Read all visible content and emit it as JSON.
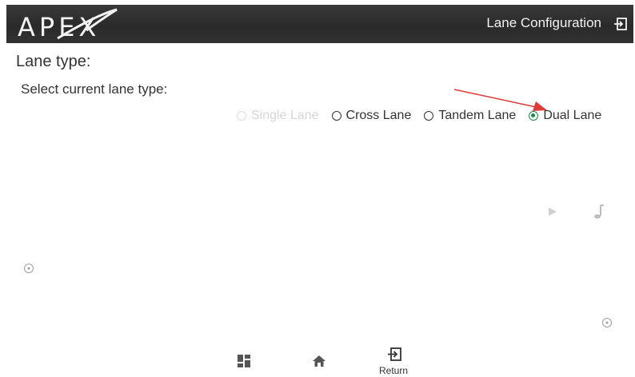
{
  "header": {
    "logo_text": "APEX",
    "title": "Lane Configuration",
    "exit_icon": "exit-icon"
  },
  "page": {
    "heading": "Lane type:",
    "subheading": "Select current lane type:"
  },
  "lane_options": [
    {
      "label": "Single Lane",
      "state": "disabled"
    },
    {
      "label": "Cross Lane",
      "state": "unselected"
    },
    {
      "label": "Tandem Lane",
      "state": "unselected"
    },
    {
      "label": "Dual Lane",
      "state": "selected"
    }
  ],
  "faint_icons": [
    "play-icon",
    "music-note-icon",
    "target-dot-icon",
    "target-dot-icon"
  ],
  "footer": {
    "dashboard_icon": "dashboard-icon",
    "home_icon": "home-icon",
    "return_label": "Return"
  },
  "colors": {
    "header_bg": "#2e2e2e",
    "selected_radio": "#1f8a4c",
    "annotation_arrow": "#e03a3a"
  }
}
